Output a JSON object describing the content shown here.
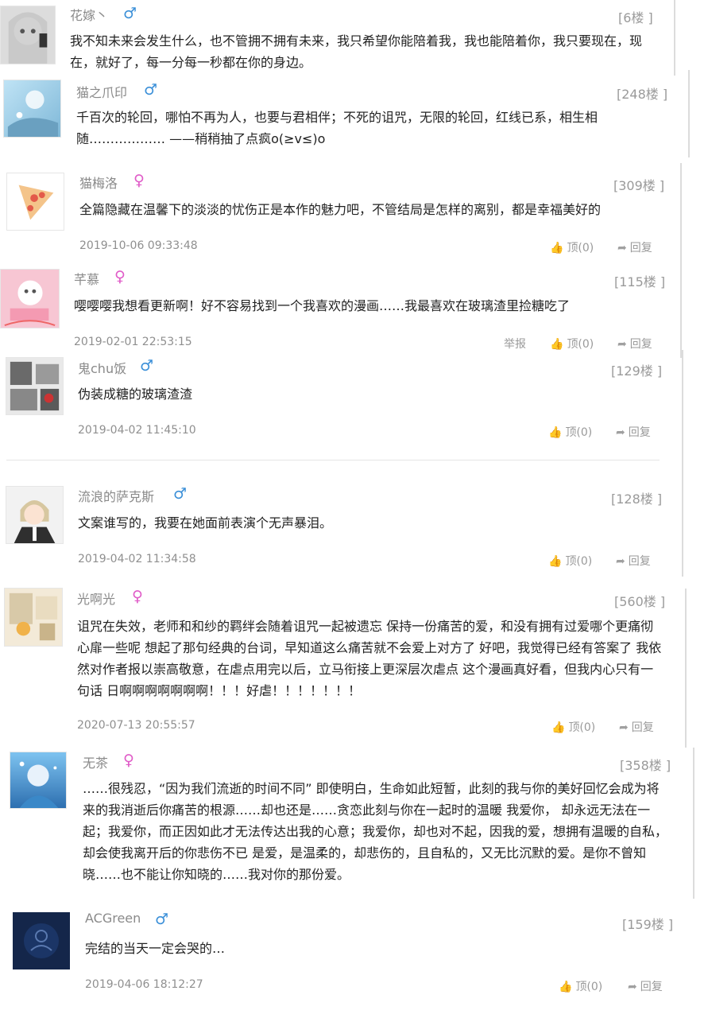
{
  "labels": {
    "up": "顶(0)",
    "reply": "回复",
    "report": "举报"
  },
  "comments": [
    {
      "user": "花嫁丶",
      "gender": "♂",
      "floor": "[6楼 ]",
      "text": "我不知未来会发生什么，也不管拥不拥有未来，我只希望你能陪着我，我也能陪着你，我只要现在，现在，就好了，每一分每一秒都在你的身边。"
    },
    {
      "user": "猫之爪印",
      "gender": "♂",
      "floor": "[248楼 ]",
      "text": "千百次的轮回，哪怕不再为人，也要与君相伴；不死的诅咒，无限的轮回，红线已系，相生相随……………… ——稍稍抽了点疯o(≥v≤)o"
    },
    {
      "user": "猫梅洛",
      "gender": "♀",
      "floor": "[309楼 ]",
      "text": "全篇隐藏在温馨下的淡淡的忧伤正是本作的魅力吧，不管结局是怎样的离别，都是幸福美好的",
      "time": "2019-10-06 09:33:48"
    },
    {
      "user": "芊慕",
      "gender": "♀",
      "floor": "[115楼 ]",
      "text": "嘤嘤嘤我想看更新啊！好不容易找到一个我喜欢的漫画……我最喜欢在玻璃渣里捡糖吃了",
      "time": "2019-02-01 22:53:15"
    },
    {
      "user": "鬼chu饭",
      "gender": "♂",
      "floor": "[129楼 ]",
      "text": "伪装成糖的玻璃渣渣",
      "time": "2019-04-02 11:45:10"
    },
    {
      "user": "流浪的萨克斯",
      "gender": "♂",
      "floor": "[128楼 ]",
      "text": "文案谁写的，我要在她面前表演个无声暴泪。",
      "time": "2019-04-02 11:34:58"
    },
    {
      "user": "光啊光",
      "gender": "♀",
      "floor": "[560楼 ]",
      "text": "诅咒在失效，老师和和纱的羁绊会随着诅咒一起被遗忘 保持一份痛苦的爱，和没有拥有过爱哪个更痛彻心扉一些呢 想起了那句经典的台词，早知道这么痛苦就不会爱上对方了 好吧，我觉得已经有答案了 我依然对作者报以崇高敬意，在虐点用完以后，立马衔接上更深层次虐点 这个漫画真好看，但我内心只有一句话 日啊啊啊啊啊啊啊！！！好虐！！！！！！！",
      "time": "2020-07-13 20:55:57"
    },
    {
      "user": "无茶",
      "gender": "♀",
      "floor": "[358楼 ]",
      "text": "……很残忍，“因为我们流逝的时间不同” 即使明白，生命如此短暂，此刻的我与你的美好回忆会成为将来的我消逝后你痛苦的根源……却也还是……贪恋此刻与你在一起时的温暖 我爱你， 却永远无法在一起；我爱你，而正因如此才无法传达出我的心意；我爱你，却也对不起，因我的爱，想拥有温暖的自私，却会使我离开后的你悲伤不已 是爱，是温柔的，却悲伤的，且自私的，又无比沉默的爱。是你不曾知晓……也不能让你知晓的……我对你的那份爱。"
    },
    {
      "user": "ACGreen",
      "gender": "♂",
      "floor": "[159楼 ]",
      "text": "完结的当天一定会哭的…",
      "time": "2019-04-06 18:12:27"
    }
  ]
}
